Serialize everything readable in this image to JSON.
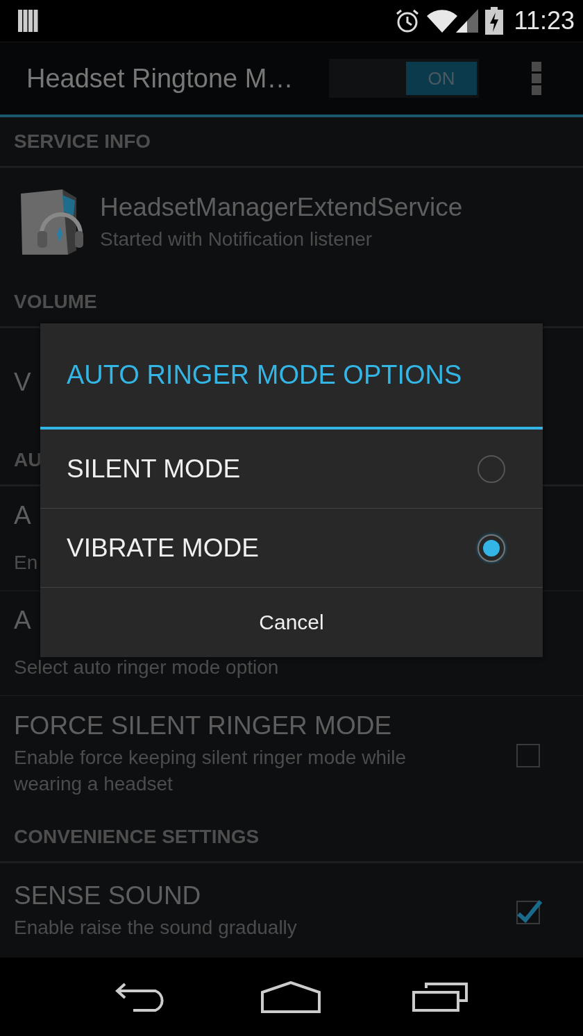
{
  "status_bar": {
    "time": "11:23"
  },
  "action_bar": {
    "title": "Headset Ringtone M…",
    "switch": {
      "label": "ON",
      "on": true
    }
  },
  "sections": [
    {
      "header": "SERVICE INFO",
      "items": [
        {
          "kind": "service",
          "title": "HeadsetManagerExtendService",
          "summary": "Started with Notification listener"
        }
      ]
    },
    {
      "header": "VOLUME",
      "items": [
        {
          "kind": "plain",
          "title": "V"
        }
      ]
    },
    {
      "header": "AU",
      "items": [
        {
          "kind": "plain",
          "title": "A",
          "summary": "En"
        },
        {
          "kind": "plain",
          "title": "A",
          "summary": "Select auto ringer mode option"
        },
        {
          "kind": "checkbox",
          "title": "FORCE SILENT RINGER MODE",
          "summary": "Enable force keeping silent ringer mode while wearing a headset",
          "checked": false
        }
      ]
    },
    {
      "header": "CONVENIENCE SETTINGS",
      "items": [
        {
          "kind": "checkbox",
          "title": "SENSE SOUND",
          "summary": "Enable raise the sound gradually",
          "checked": true
        }
      ]
    }
  ],
  "dialog": {
    "title": "AUTO RINGER MODE OPTIONS",
    "options": [
      {
        "label": "SILENT MODE",
        "selected": false
      },
      {
        "label": "VIBRATE MODE",
        "selected": true
      }
    ],
    "cancel": "Cancel"
  }
}
